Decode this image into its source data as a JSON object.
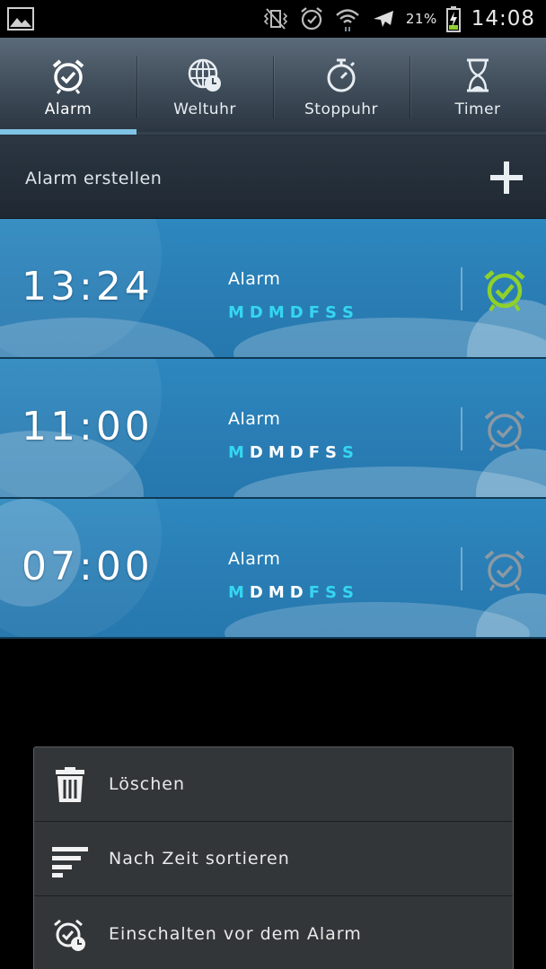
{
  "status_bar": {
    "battery_percent": "21%",
    "time": "14:08",
    "icons": [
      "gallery-icon",
      "vibrate-icon",
      "alarm-icon",
      "wifi-icon",
      "airplane-icon",
      "battery-charging-icon"
    ]
  },
  "tabs": [
    {
      "label": "Alarm",
      "icon": "alarm-clock-icon",
      "active": true
    },
    {
      "label": "Weltuhr",
      "icon": "world-clock-icon",
      "active": false
    },
    {
      "label": "Stoppuhr",
      "icon": "stopwatch-icon",
      "active": false
    },
    {
      "label": "Timer",
      "icon": "hourglass-icon",
      "active": false
    }
  ],
  "create_alarm": {
    "label": "Alarm erstellen",
    "icon": "plus-icon"
  },
  "alarms": [
    {
      "time": "13:24",
      "name": "Alarm",
      "days": [
        "M",
        "D",
        "M",
        "D",
        "F",
        "S",
        "S"
      ],
      "days_on": [
        true,
        true,
        true,
        true,
        true,
        true,
        true
      ],
      "enabled": true
    },
    {
      "time": "11:00",
      "name": "Alarm",
      "days": [
        "M",
        "D",
        "M",
        "D",
        "F",
        "S",
        "S"
      ],
      "days_on": [
        true,
        false,
        false,
        false,
        false,
        false,
        true
      ],
      "enabled": false
    },
    {
      "time": "07:00",
      "name": "Alarm",
      "days": [
        "M",
        "D",
        "M",
        "D",
        "F",
        "S",
        "S"
      ],
      "days_on": [
        true,
        false,
        false,
        false,
        true,
        true,
        true
      ],
      "enabled": false
    }
  ],
  "menu": {
    "items": [
      {
        "label": "Löschen",
        "icon": "trash-icon"
      },
      {
        "label": "Nach Zeit sortieren",
        "icon": "sort-icon"
      },
      {
        "label": "Einschalten vor dem Alarm",
        "icon": "alarm-clock-icon"
      }
    ]
  },
  "colors": {
    "tab_indicator": "#7fc4e6",
    "active_day": "#35d6f0",
    "alarm_on": "#8fd12a",
    "alarm_off": "#8c99a3",
    "row_background": "#2a7fb6"
  }
}
